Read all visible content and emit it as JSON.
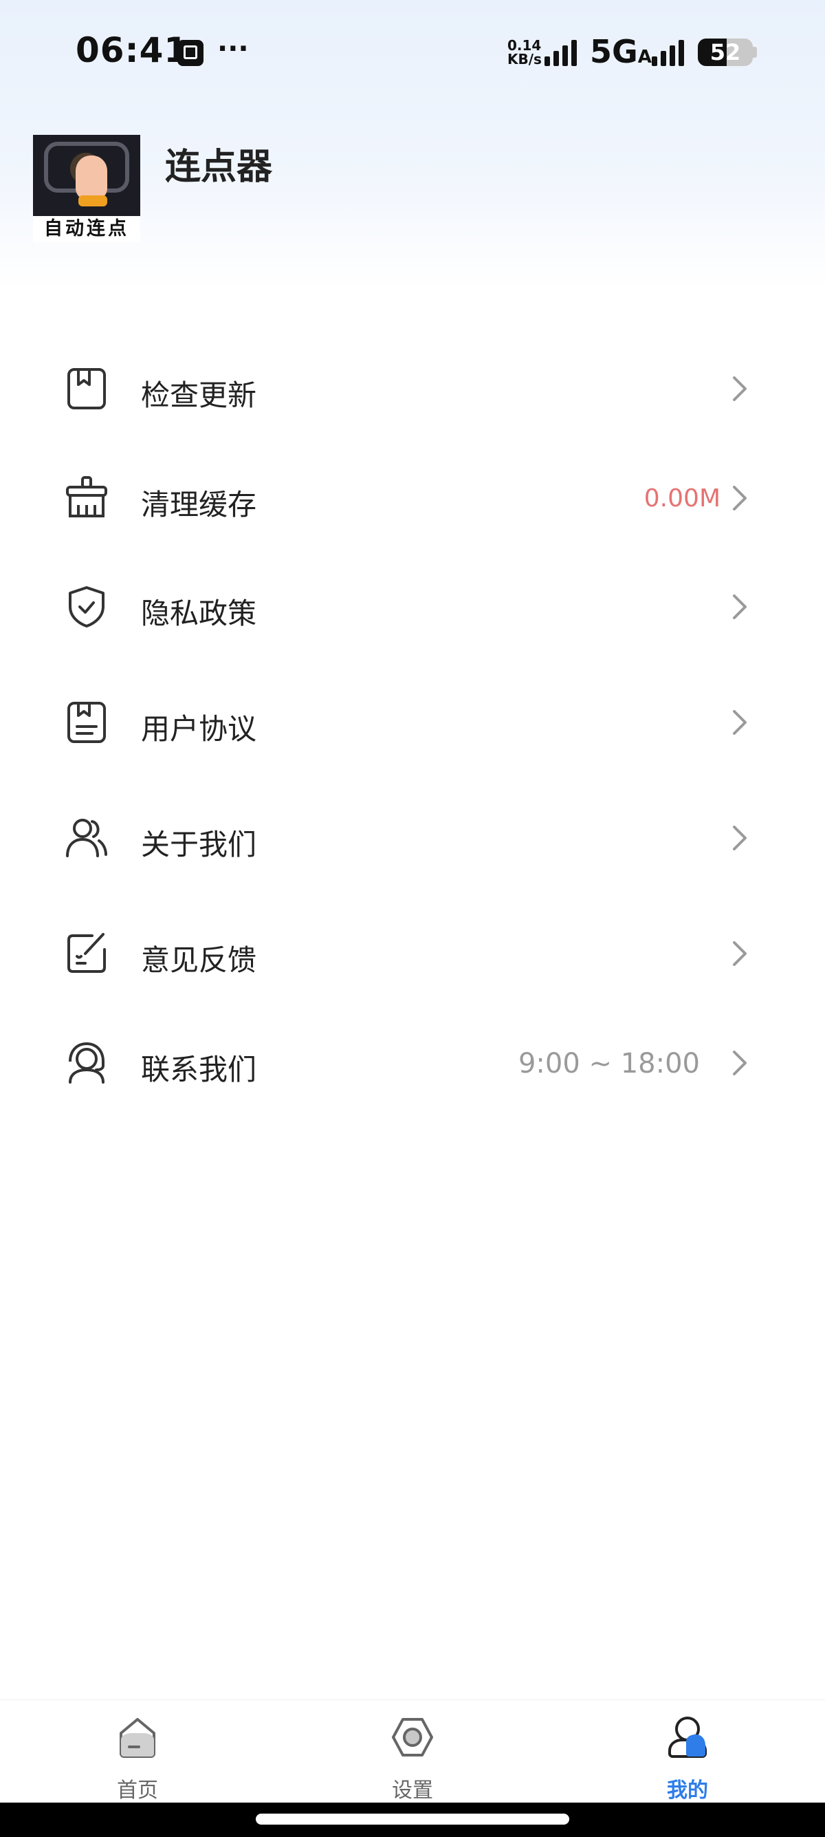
{
  "status_bar": {
    "time": "06:41",
    "more": "···",
    "net_speed_value": "0.14",
    "net_speed_unit": "KB/s",
    "network": "5G",
    "network_sub": "A",
    "battery": "52",
    "battery_level": 0.52
  },
  "header": {
    "logo_text": "自动连点",
    "title": "连点器"
  },
  "menu": [
    {
      "icon": "bookmark-icon",
      "label": "检查更新",
      "value": ""
    },
    {
      "icon": "broom-icon",
      "label": "清理缓存",
      "value": "0.00M"
    },
    {
      "icon": "shield-check-icon",
      "label": "隐私政策",
      "value": ""
    },
    {
      "icon": "document-icon",
      "label": "用户协议",
      "value": ""
    },
    {
      "icon": "users-icon",
      "label": "关于我们",
      "value": ""
    },
    {
      "icon": "edit-icon",
      "label": "意见反馈",
      "value": ""
    },
    {
      "icon": "headset-icon",
      "label": "联系我们",
      "value": "9:00 ~ 18:00"
    }
  ],
  "colors": {
    "accent": "#2e7de8",
    "cache_value": "#e57373",
    "time_value": "#9a9a9a"
  },
  "bottom_nav": [
    {
      "icon": "home-icon",
      "label": "首页",
      "active": false
    },
    {
      "icon": "settings-icon",
      "label": "设置",
      "active": false
    },
    {
      "icon": "profile-icon",
      "label": "我的",
      "active": true
    }
  ]
}
